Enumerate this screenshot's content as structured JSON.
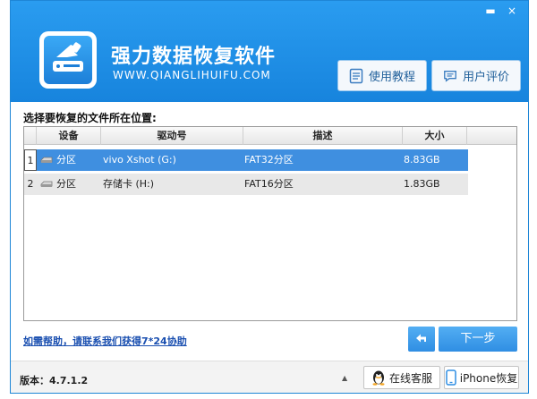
{
  "window": {
    "title": "强力数据恢复软件",
    "site": "WWW.QIANGLIHUIFU.COM",
    "minimize_glyph": "▬",
    "close_glyph": "×",
    "accent_color": "#1784dd"
  },
  "header_buttons": {
    "tutorial_label": "使用教程",
    "review_label": "用户评价"
  },
  "prompt": "选择要恢复的文件所在位置:",
  "table": {
    "columns": [
      "设备",
      "驱动号",
      "描述",
      "大小"
    ],
    "rows": [
      {
        "index": "1",
        "device": "分区",
        "drive": "vivo Xshot (G:)",
        "desc": "FAT32分区",
        "size": "8.83GB",
        "selected": true
      },
      {
        "index": "2",
        "device": "分区",
        "drive": "存储卡 (H:)",
        "desc": "FAT16分区",
        "size": "1.83GB",
        "selected": false
      }
    ]
  },
  "help_link": "如需帮助，请联系我们获得7*24协助",
  "nav": {
    "next_label": "下一步",
    "back_icon": "back-arrow-icon"
  },
  "footer": {
    "version": "版本：4.7.1.2",
    "service_label": "在线客服",
    "iphone_label": "iPhone恢复"
  }
}
